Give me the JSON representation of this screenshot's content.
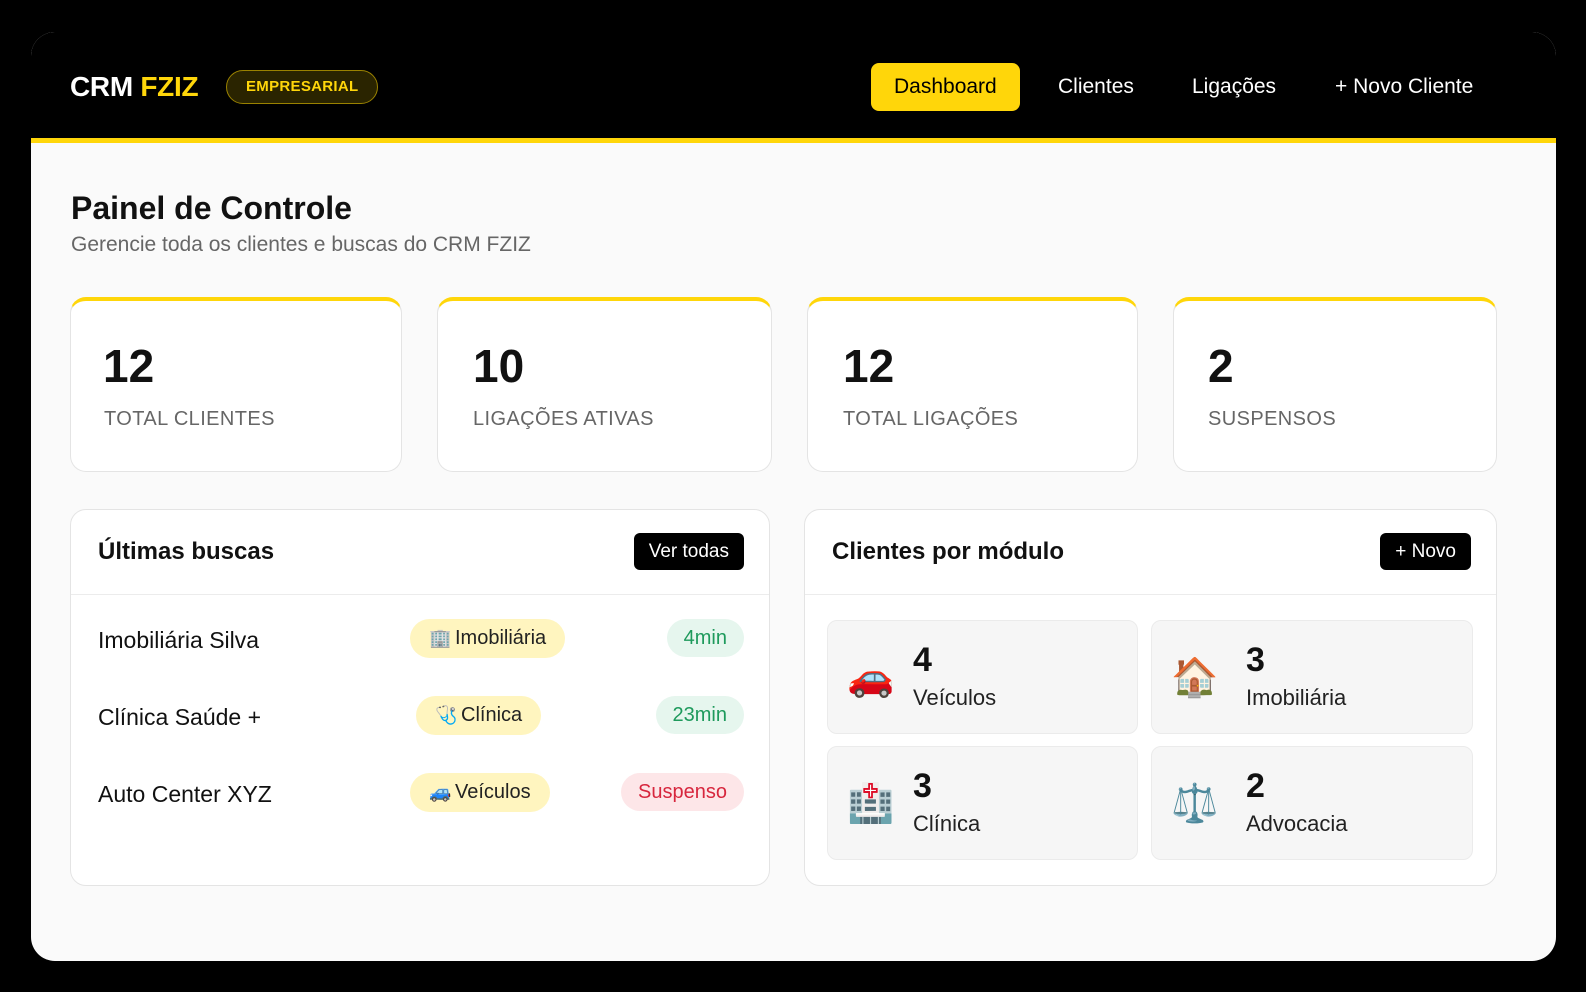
{
  "brand": {
    "name": "CRM",
    "accent": "FZIZ",
    "badge": "EMPRESARIAL"
  },
  "nav": [
    {
      "label": "Dashboard",
      "active": true
    },
    {
      "label": "Clientes",
      "active": false
    },
    {
      "label": "Ligações",
      "active": false
    },
    {
      "label": "+ Novo Cliente",
      "active": false
    }
  ],
  "page": {
    "title": "Painel de Controle",
    "subtitle": "Gerencie toda os clientes e buscas do CRM FZIZ"
  },
  "stats": [
    {
      "value": "12",
      "label": "TOTAL CLIENTES"
    },
    {
      "value": "10",
      "label": "LIGAÇÕES ATIVAS"
    },
    {
      "value": "12",
      "label": "TOTAL LIGAÇÕES"
    },
    {
      "value": "2",
      "label": "SUSPENSOS"
    }
  ],
  "recent": {
    "title": "Últimas buscas",
    "button": "Ver todas",
    "items": [
      {
        "name": "Imobiliária Silva",
        "tag_icon": "building-icon",
        "tag_glyph": "🏢",
        "tag": "Imobiliária",
        "time": "4min",
        "status": "ok"
      },
      {
        "name": "Clínica Saúde +",
        "tag_icon": "stethoscope-icon",
        "tag_glyph": "🩺",
        "tag": "Clínica",
        "time": "23min",
        "status": "ok"
      },
      {
        "name": "Auto Center XYZ",
        "tag_icon": "car-icon",
        "tag_glyph": "🚙",
        "tag": "Veículos",
        "time": "Suspenso",
        "status": "bad"
      }
    ]
  },
  "modules": {
    "title": "Clientes por módulo",
    "button": "+ Novo",
    "items": [
      {
        "count": "4",
        "label": "Veículos",
        "icon": "car-icon",
        "glyph": "🚗"
      },
      {
        "count": "3",
        "label": "Imobiliária",
        "icon": "house-icon",
        "glyph": "🏠"
      },
      {
        "count": "3",
        "label": "Clínica",
        "icon": "hospital-icon",
        "glyph": "🏥"
      },
      {
        "count": "2",
        "label": "Advocacia",
        "icon": "scales-icon",
        "glyph": "⚖️"
      }
    ]
  },
  "colors": {
    "accent": "#ffd60a",
    "ok": "#1e9a5c",
    "danger": "#d7263d"
  }
}
